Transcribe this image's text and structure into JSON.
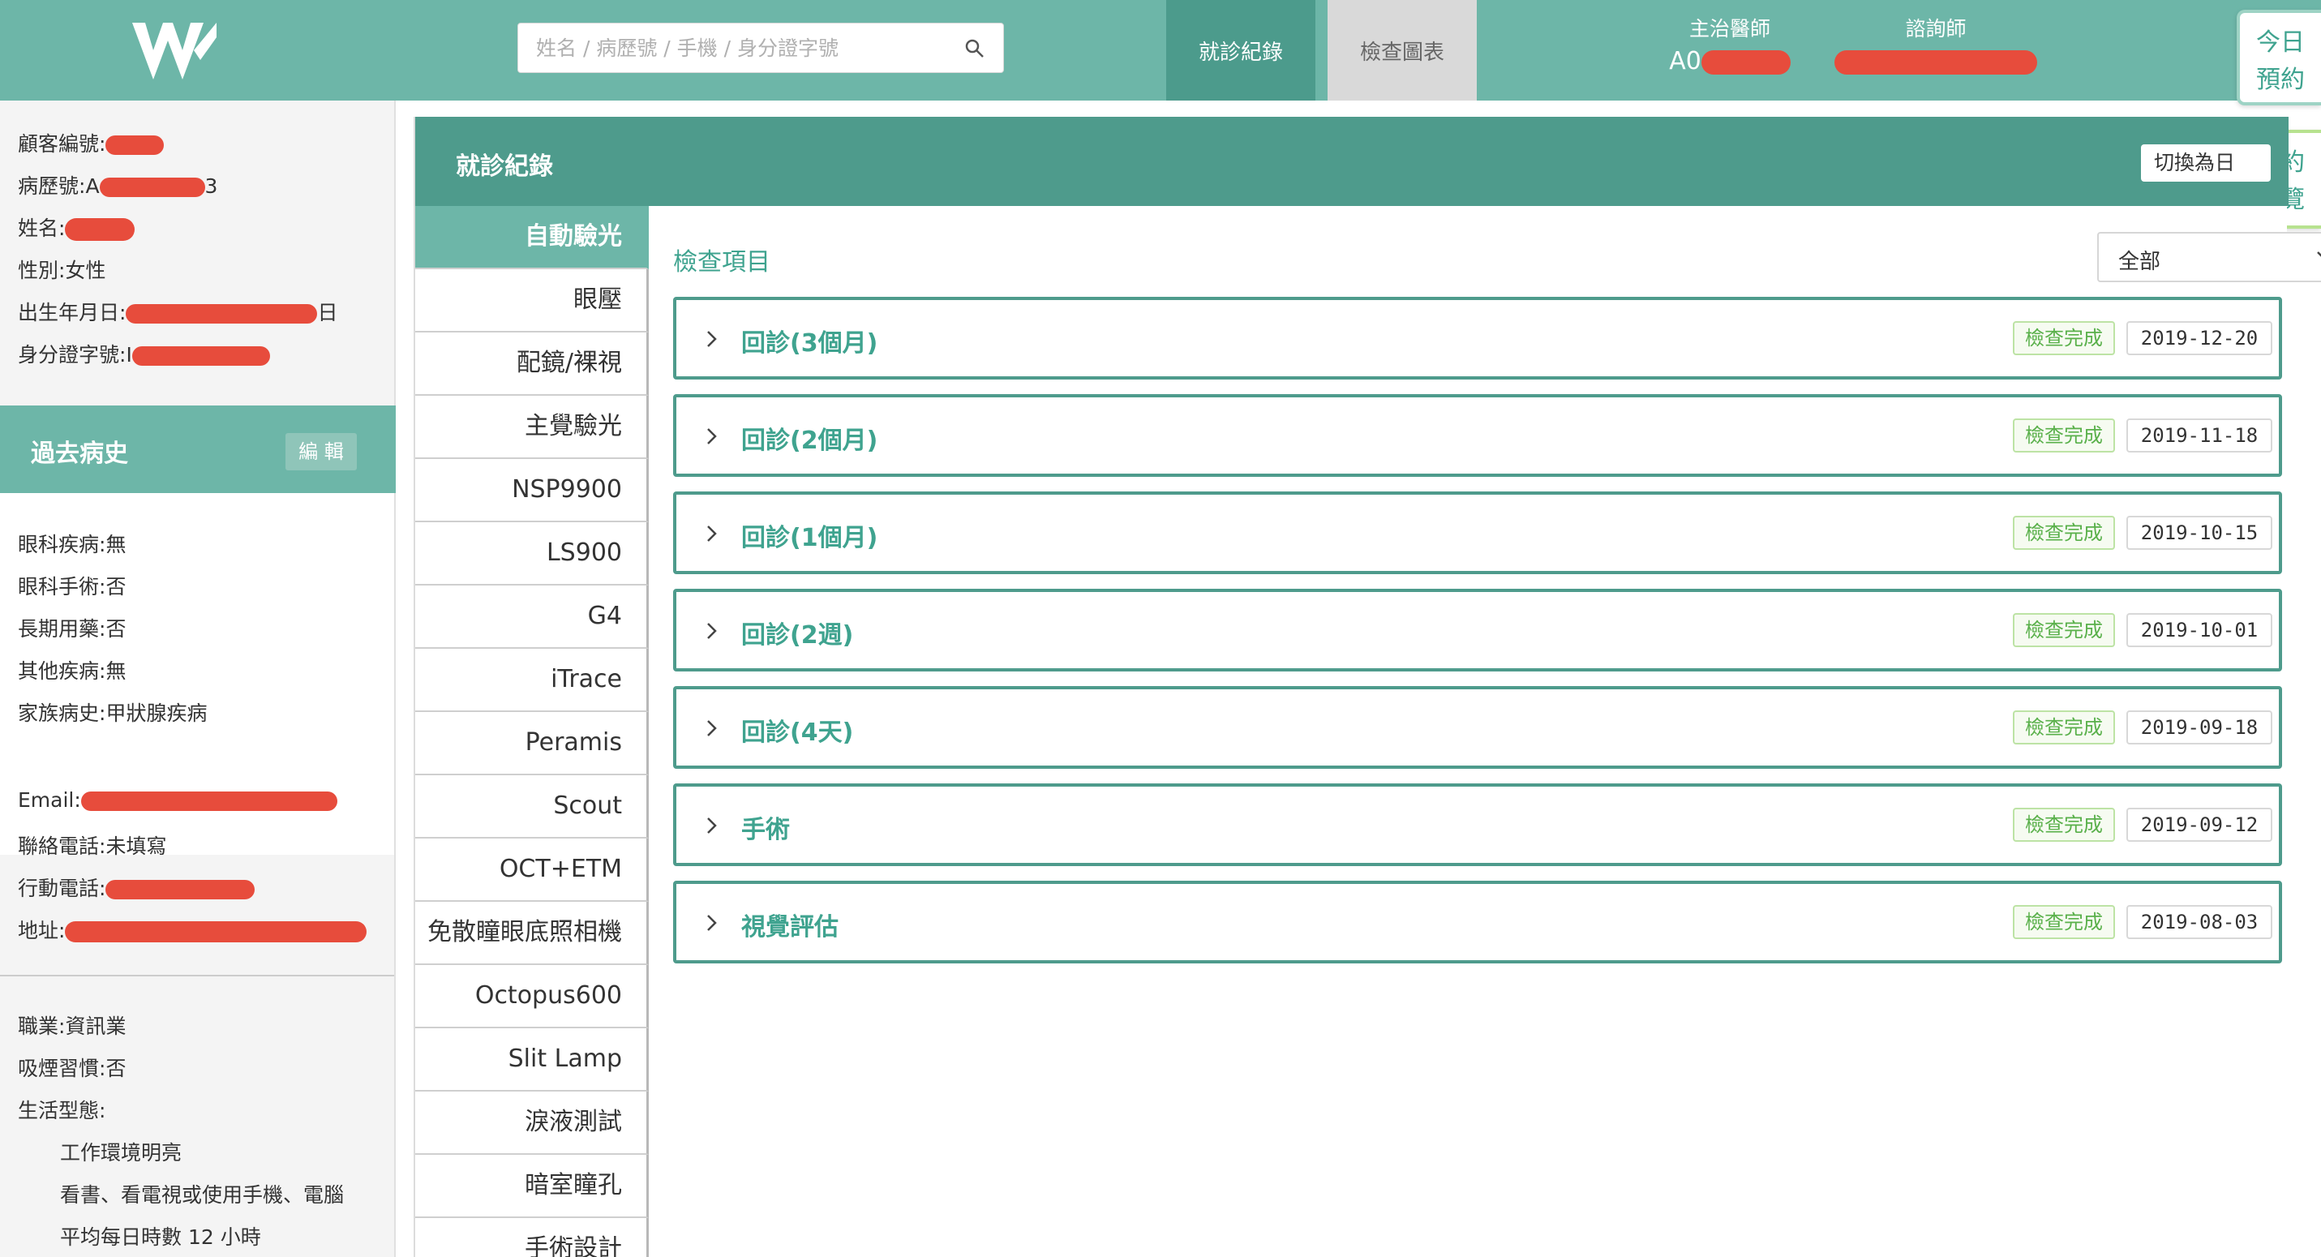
{
  "header": {
    "search_placeholder": "姓名 / 病歷號 / 手機 / 身分證字號",
    "tabs": [
      {
        "label": "就診紀錄",
        "active": true
      },
      {
        "label": "檢查圖表",
        "active": false
      }
    ],
    "doctor_role": "主治醫師",
    "doctor_value": "A0",
    "consultant_role": "諮詢師",
    "accent_color": "#6db6a8"
  },
  "floating": {
    "today_line1": "今日",
    "today_line2": "預約",
    "list_line1": "預約",
    "list_line2": "一覽"
  },
  "sidebar": {
    "basic": [
      {
        "label": "顧客編號:",
        "value": ""
      },
      {
        "label": "病歷號:",
        "value": "A",
        "tail": "3"
      },
      {
        "label": "姓名:",
        "value": ""
      },
      {
        "label": "性別:",
        "value": "女性"
      },
      {
        "label": "出生年月日:",
        "value": "",
        "tail": "日"
      },
      {
        "label": "身分證字號:",
        "value": "I"
      }
    ],
    "history_title": "過去病史",
    "edit_label": "編 輯",
    "history": [
      {
        "label": "眼科疾病:",
        "value": "無"
      },
      {
        "label": "眼科手術:",
        "value": "否"
      },
      {
        "label": "長期用藥:",
        "value": "否"
      },
      {
        "label": "其他疾病:",
        "value": "無"
      },
      {
        "label": "家族病史:",
        "value": "甲狀腺疾病"
      }
    ],
    "contact": [
      {
        "label": "Email:",
        "value": ""
      },
      {
        "label": "聯絡電話:",
        "value": "未填寫"
      },
      {
        "label": "行動電話:",
        "value": ""
      },
      {
        "label": "地址:",
        "value": ""
      }
    ],
    "lifestyle": [
      {
        "label": "職業:",
        "value": "資訊業"
      },
      {
        "label": "吸煙習慣:",
        "value": "否"
      },
      {
        "label": "生活型態:",
        "value": ""
      }
    ],
    "lifestyle_details": [
      "工作環境明亮",
      "看書、看電視或使用手機、電腦",
      "平均每日時數 12 小時"
    ]
  },
  "panel": {
    "title": "就診紀錄",
    "switch_label": "切換為日",
    "exam_items": [
      {
        "label": "自動驗光",
        "active": true
      },
      {
        "label": "眼壓"
      },
      {
        "label": "配鏡/裸視"
      },
      {
        "label": "主覺驗光"
      },
      {
        "label": "NSP9900"
      },
      {
        "label": "LS900"
      },
      {
        "label": "G4"
      },
      {
        "label": "iTrace"
      },
      {
        "label": "Peramis"
      },
      {
        "label": "Scout"
      },
      {
        "label": "OCT+ETM"
      },
      {
        "label": "免散瞳眼底照相機"
      },
      {
        "label": "Octopus600"
      },
      {
        "label": "Slit Lamp"
      },
      {
        "label": "淚液測試"
      },
      {
        "label": "暗室瞳孔"
      },
      {
        "label": "手術設計"
      }
    ],
    "content_title": "檢查項目",
    "filter_value": "全部",
    "visits": [
      {
        "label": "回診(3個月)",
        "status": "檢查完成",
        "date": "2019-12-20"
      },
      {
        "label": "回診(2個月)",
        "status": "檢查完成",
        "date": "2019-11-18"
      },
      {
        "label": "回診(1個月)",
        "status": "檢查完成",
        "date": "2019-10-15"
      },
      {
        "label": "回診(2週)",
        "status": "檢查完成",
        "date": "2019-10-01"
      },
      {
        "label": "回診(4天)",
        "status": "檢查完成",
        "date": "2019-09-18"
      },
      {
        "label": "手術",
        "status": "檢查完成",
        "date": "2019-09-12"
      },
      {
        "label": "視覺評估",
        "status": "檢查完成",
        "date": "2019-08-03"
      }
    ]
  }
}
